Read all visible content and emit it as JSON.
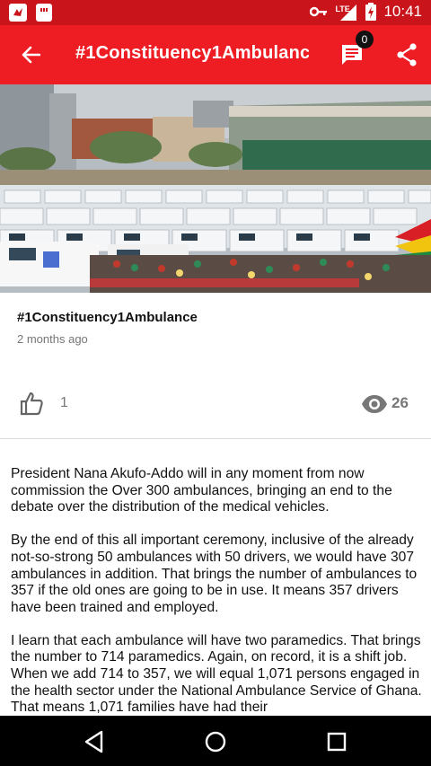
{
  "status_bar": {
    "time": "10:41",
    "network": "LTE",
    "icons": [
      "app-notification-icon",
      "sd-card-icon",
      "key-icon",
      "signal-icon",
      "battery-charging-icon"
    ]
  },
  "app_bar": {
    "title": "#1Constituency1Ambulanc",
    "comment_count": "0",
    "colors": {
      "status": "#c9141b",
      "bar": "#ee1c23"
    }
  },
  "hero": {
    "icon": "ambulances-photo"
  },
  "post": {
    "title": "#1Constituency1Ambulance",
    "time_ago": "2 months ago",
    "likes": "1",
    "views": "26"
  },
  "article": {
    "paragraphs": [
      "President Nana Akufo-Addo will in any moment from now commission the Over 300 ambulances, bringing an end to the debate over the distribution of the medical vehicles.",
      "By the end of this all important ceremony, inclusive of the already not-so-strong 50 ambulances with 50 drivers, we would have 307 ambulances in addition. That brings the number of ambulances to 357 if the old ones are going to be in use. It means 357 drivers have been trained and employed.",
      "I learn that each ambulance will have two paramedics. That brings the number to 714 paramedics. Again, on record, it is a shift job. When we add 714 to 357, we will equal 1,071 persons engaged in the health sector under the National Ambulance Service of Ghana. That means 1,071 families have had their"
    ]
  },
  "nav_bar": {
    "icons": [
      "back-triangle-icon",
      "home-circle-icon",
      "recents-square-icon"
    ]
  }
}
